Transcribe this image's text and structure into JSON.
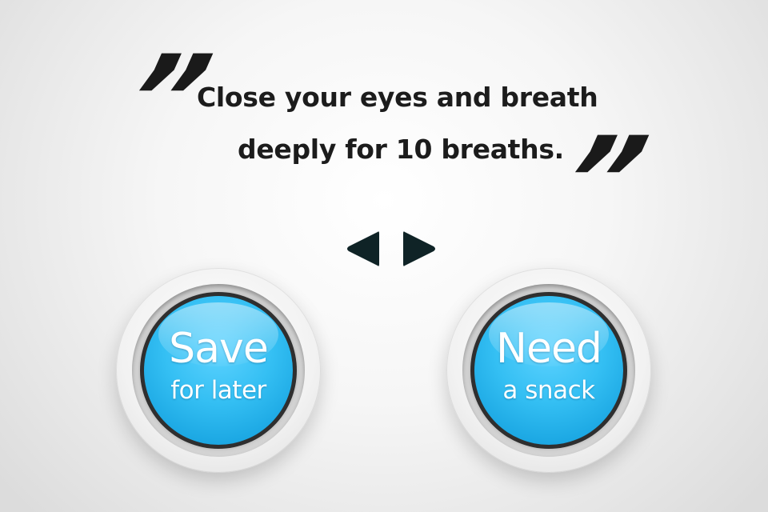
{
  "quote": {
    "open_mark": "”",
    "close_mark": "”",
    "line1": "Close your eyes and breath",
    "line2": "deeply for 10 breaths."
  },
  "navigation": {
    "prev_icon": "triangle-left-icon",
    "next_icon": "triangle-right-icon"
  },
  "buttons": {
    "save": {
      "line1": "Save",
      "line2": "for later"
    },
    "snack": {
      "line1": "Need",
      "line2": "a snack"
    }
  },
  "colors": {
    "button_blue": "#34bff3",
    "text_dark": "#1c1c1c",
    "arrow": "#0f2326"
  }
}
